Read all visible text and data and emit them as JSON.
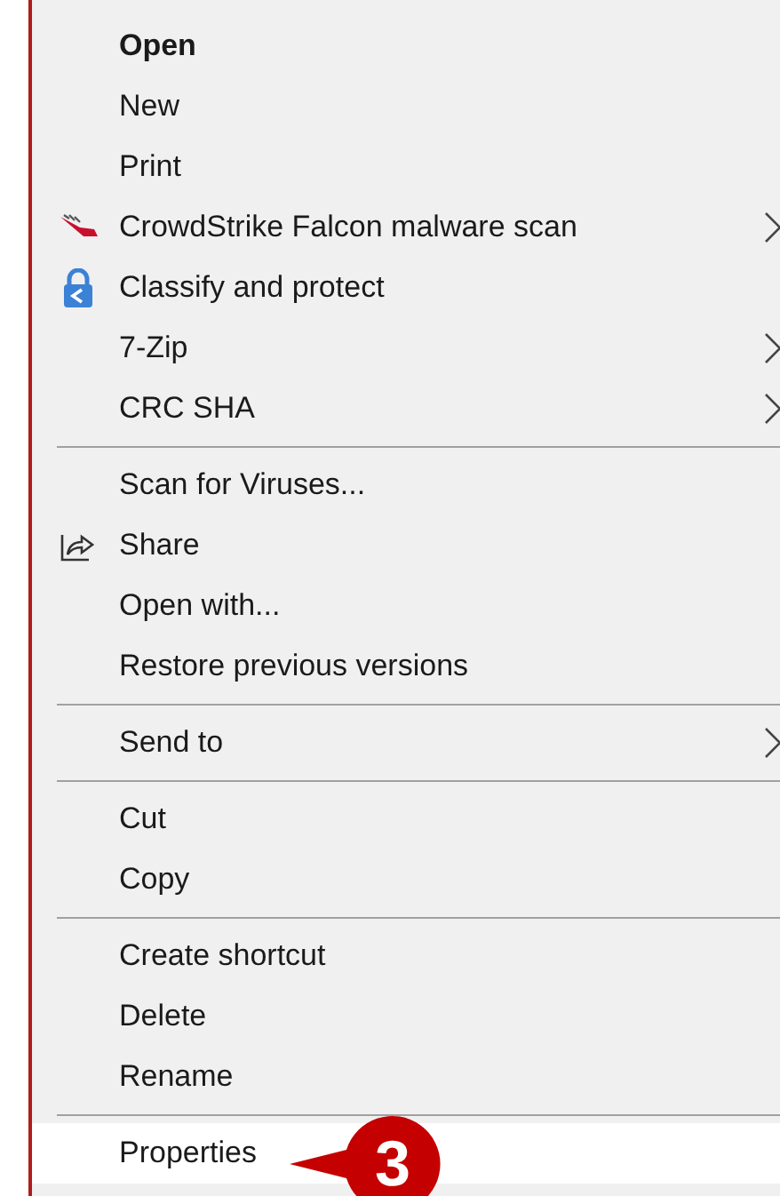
{
  "menu": {
    "sections": [
      {
        "items": [
          {
            "label": "Open",
            "kind": "plain",
            "default": true,
            "submenu": false,
            "selected": false
          },
          {
            "label": "New",
            "kind": "plain",
            "default": false,
            "submenu": false,
            "selected": false
          },
          {
            "label": "Print",
            "kind": "plain",
            "default": false,
            "submenu": false,
            "selected": false
          },
          {
            "label": "CrowdStrike Falcon malware scan",
            "kind": "bird",
            "default": false,
            "submenu": true,
            "selected": false
          },
          {
            "label": "Classify and protect",
            "kind": "lock",
            "default": false,
            "submenu": false,
            "selected": false
          },
          {
            "label": "7-Zip",
            "kind": "plain",
            "default": false,
            "submenu": true,
            "selected": false
          },
          {
            "label": "CRC SHA",
            "kind": "plain",
            "default": false,
            "submenu": true,
            "selected": false
          }
        ]
      },
      {
        "items": [
          {
            "label": "Scan for Viruses...",
            "kind": "plain",
            "default": false,
            "submenu": false,
            "selected": false
          },
          {
            "label": "Share",
            "kind": "share",
            "default": false,
            "submenu": false,
            "selected": false
          },
          {
            "label": "Open with...",
            "kind": "plain",
            "default": false,
            "submenu": false,
            "selected": false
          },
          {
            "label": "Restore previous versions",
            "kind": "plain",
            "default": false,
            "submenu": false,
            "selected": false
          }
        ]
      },
      {
        "items": [
          {
            "label": "Send to",
            "kind": "plain",
            "default": false,
            "submenu": true,
            "selected": false
          }
        ]
      },
      {
        "items": [
          {
            "label": "Cut",
            "kind": "plain",
            "default": false,
            "submenu": false,
            "selected": false
          },
          {
            "label": "Copy",
            "kind": "plain",
            "default": false,
            "submenu": false,
            "selected": false
          }
        ]
      },
      {
        "items": [
          {
            "label": "Create shortcut",
            "kind": "plain",
            "default": false,
            "submenu": false,
            "selected": false
          },
          {
            "label": "Delete",
            "kind": "plain",
            "default": false,
            "submenu": false,
            "selected": false
          },
          {
            "label": "Rename",
            "kind": "plain",
            "default": false,
            "submenu": false,
            "selected": false
          }
        ]
      },
      {
        "items": [
          {
            "label": "Properties",
            "kind": "plain",
            "default": false,
            "submenu": false,
            "selected": true
          }
        ]
      }
    ]
  },
  "callout": {
    "label": "3"
  }
}
